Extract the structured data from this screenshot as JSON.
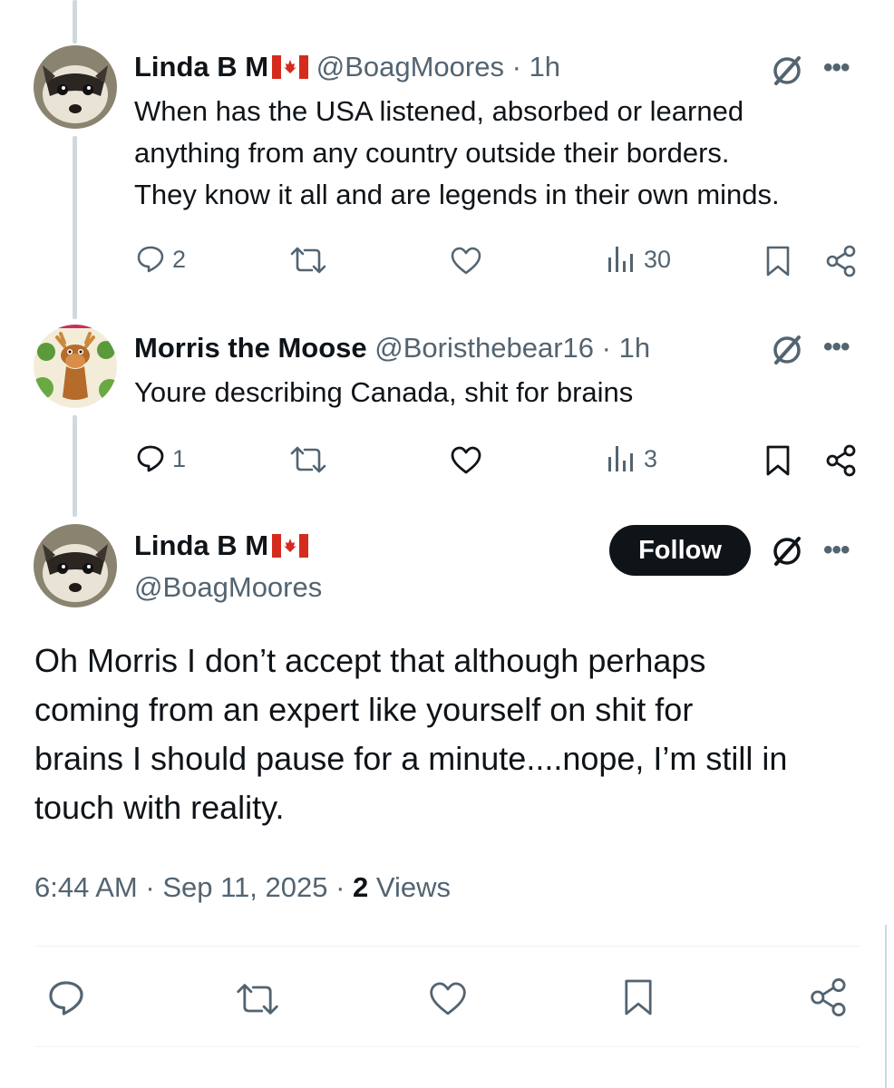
{
  "thread": {
    "reply1": {
      "name": "Linda B M",
      "handle": "@BoagMoores",
      "separator": "·",
      "time": "1h",
      "text_lines": [
        "When has the USA listened, absorbed or learned",
        "anything from any country outside their borders.",
        "They know it all and are legends in their own minds."
      ],
      "replies": "2",
      "views": "30"
    },
    "reply2": {
      "name": "Morris the Moose",
      "handle": "@Boristhebear16",
      "separator": "·",
      "time": "1h",
      "text_lines": [
        "Youre describing Canada, shit for brains"
      ],
      "replies": "1",
      "views": "3"
    }
  },
  "main_post": {
    "name": "Linda B M",
    "handle": "@BoagMoores",
    "follow_label": "Follow",
    "text_lines": [
      "Oh Morris I don’t accept that although perhaps",
      "coming from an expert like yourself on shit for",
      "brains I should pause for a minute....nope, I’m still in",
      "touch with reality."
    ],
    "time": "6:44 AM",
    "sep1": "·",
    "date": "Sep 11, 2025",
    "sep2": "·",
    "views_count": "2",
    "views_label": "Views"
  },
  "more_label": "•••",
  "colors": {
    "text": "#0f1419",
    "secondary": "#536471",
    "follow_bg": "#0f1419",
    "thread_line": "#cfd9de",
    "flag_red": "#d52b1e"
  },
  "icons": [
    "reply-icon",
    "repost-icon",
    "like-icon",
    "views-icon",
    "bookmark-icon",
    "share-icon",
    "grok-icon",
    "more-icon",
    "canada-flag-icon"
  ]
}
